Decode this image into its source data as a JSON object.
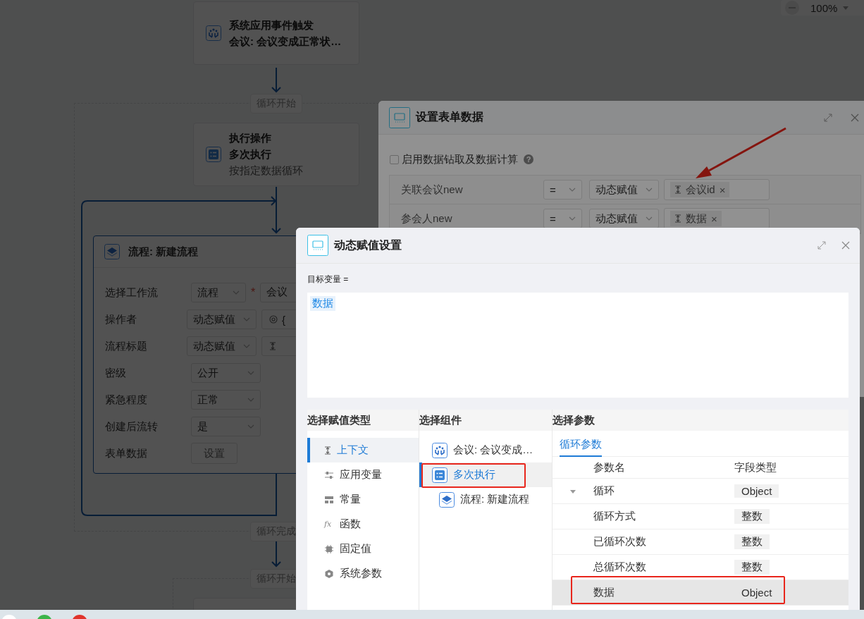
{
  "zoom": {
    "value": "100%"
  },
  "flow": {
    "nodes": [
      {
        "kind": "trigger",
        "lines": [
          "系统应用事件触发",
          "会议: 会议变成正常状…"
        ]
      },
      {
        "kind": "action",
        "lines": [
          "执行操作",
          "多次执行"
        ],
        "note": "按指定数据循环"
      }
    ],
    "loop_labels": [
      "循环开始",
      "循环完成",
      "循环开始"
    ],
    "process_card": {
      "title": "流程: 新建流程",
      "fields": [
        {
          "label": "选择工作流",
          "kind": "select",
          "value": "流程",
          "required_mark": "*",
          "extra": {
            "kind": "text-input",
            "text": "会议"
          }
        },
        {
          "label": "操作者",
          "kind": "select",
          "value": "动态赋值",
          "extra": {
            "kind": "system-tag",
            "text": "{"
          }
        },
        {
          "label": "流程标题",
          "kind": "select",
          "value": "动态赋值",
          "extra": {
            "kind": "context-tag"
          }
        },
        {
          "label": "密级",
          "kind": "select",
          "value": "公开"
        },
        {
          "label": "紧急程度",
          "kind": "select",
          "value": "正常"
        },
        {
          "label": "创建后流转",
          "kind": "select",
          "value": "是"
        },
        {
          "label": "表单数据",
          "kind": "button",
          "value": "设置"
        }
      ]
    }
  },
  "form_dialog": {
    "title": "设置表单数据",
    "drill_checkbox": {
      "label": "启用数据钻取及数据计算",
      "checked": false,
      "help": "?"
    },
    "rows": [
      {
        "field": "关联会议new",
        "operator": "=",
        "mode": "动态赋值",
        "tag": "会议id",
        "remove": "×"
      },
      {
        "field": "参会人new",
        "operator": "=",
        "mode": "动态赋值",
        "tag": "数据",
        "remove": "×"
      }
    ]
  },
  "assign_dialog": {
    "title": "动态赋值设置",
    "target_label": "目标变量 =",
    "target_tags": [
      "数据"
    ],
    "type_panel": {
      "heading": "选择赋值类型",
      "items": [
        {
          "kind": "context",
          "label": "上下文",
          "selected": true
        },
        {
          "kind": "app-variable",
          "label": "应用变量",
          "selected": false
        },
        {
          "kind": "constant",
          "label": "常量",
          "selected": false
        },
        {
          "kind": "function",
          "symbol": "fx",
          "label": "函数",
          "selected": false
        },
        {
          "kind": "fixed",
          "label": "固定值",
          "selected": false
        },
        {
          "kind": "system",
          "label": "系统参数",
          "selected": false
        }
      ]
    },
    "component_panel": {
      "heading": "选择组件",
      "items": [
        {
          "kind": "trigger",
          "label": "会议: 会议变成…",
          "selected": false
        },
        {
          "kind": "action",
          "label": "多次执行",
          "selected": true,
          "children": [
            {
              "kind": "process",
              "label": "流程: 新建流程",
              "selected": false
            }
          ]
        }
      ]
    },
    "param_panel": {
      "heading": "选择参数",
      "tabs": [
        {
          "label": "循环参数",
          "selected": true
        }
      ],
      "columns": [
        "参数名",
        "字段类型"
      ],
      "rows": [
        {
          "name": "循环",
          "type": "Object",
          "selected": false,
          "expanded": true,
          "children": [
            {
              "name": "循环方式",
              "type": "整数",
              "selected": false
            },
            {
              "name": "已循环次数",
              "type": "整数",
              "selected": false
            },
            {
              "name": "总循环次数",
              "type": "整数",
              "selected": false
            },
            {
              "name": "数据",
              "type": "Object",
              "selected": true
            }
          ]
        }
      ]
    }
  }
}
